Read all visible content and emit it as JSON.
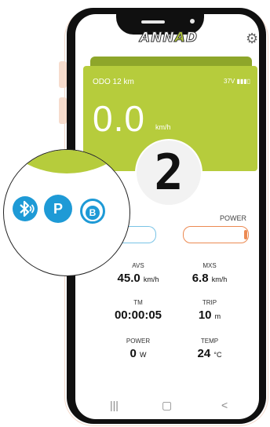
{
  "app": {
    "brand_prefix": "ANN",
    "brand_accent": "A",
    "brand_suffix": "D"
  },
  "settings_icon": "gear-icon",
  "display": {
    "odo": "ODO 12 km",
    "battery": "37V ▮▮▮▯",
    "speed": "0.0",
    "speed_unit": "km/h",
    "gear": "2",
    "power_label": "POWER"
  },
  "stats": {
    "avs_label": "AVS",
    "avs_value": "45.0",
    "avs_unit": "km/h",
    "mxs_label": "MXS",
    "mxs_value": "6.8",
    "mxs_unit": "km/h",
    "tm_label": "TM",
    "tm_value": "00:00:05",
    "trip_label": "TRIP",
    "trip_value": "10",
    "trip_unit": "m",
    "power_label": "POWER",
    "power_value": "0",
    "power_unit": "W",
    "temp_label": "TEMP",
    "temp_value": "24",
    "temp_unit": "°C"
  },
  "zoom": {
    "bluetooth_icon": "bluetooth-icon",
    "parking_icon": "parking-icon",
    "p_label": "P",
    "b_label": "B"
  },
  "nav": {
    "recent": "|||",
    "home": "▢",
    "back": "<"
  },
  "colors": {
    "accent": "#b6cc3c",
    "accent_dark": "#8ea62a",
    "blue": "#1e9ad6",
    "orange": "#ec8a52"
  }
}
